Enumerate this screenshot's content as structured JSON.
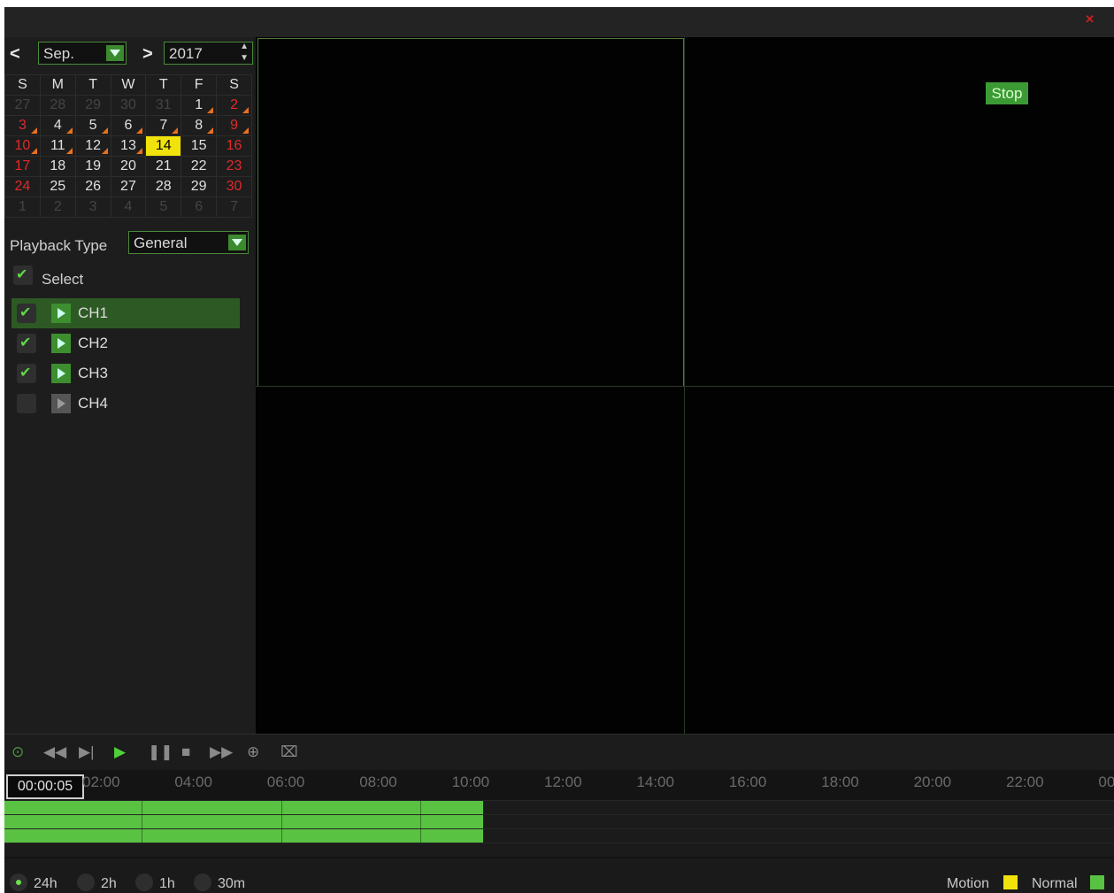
{
  "calendar": {
    "month": "Sep.",
    "year": "2017",
    "weekdays": [
      "S",
      "M",
      "T",
      "W",
      "T",
      "F",
      "S"
    ],
    "weeks": [
      [
        "27",
        "28",
        "29",
        "30",
        "31",
        "1",
        "2"
      ],
      [
        "3",
        "4",
        "5",
        "6",
        "7",
        "8",
        "9"
      ],
      [
        "10",
        "11",
        "12",
        "13",
        "14",
        "15",
        "16"
      ],
      [
        "17",
        "18",
        "19",
        "20",
        "21",
        "22",
        "23"
      ],
      [
        "24",
        "25",
        "26",
        "27",
        "28",
        "29",
        "30"
      ],
      [
        "1",
        "2",
        "3",
        "4",
        "5",
        "6",
        "7"
      ]
    ],
    "selected_day": "14"
  },
  "playback_type": {
    "label": "Playback Type",
    "value": "General"
  },
  "select_all": {
    "label": "Select",
    "checked": true
  },
  "channels": [
    {
      "label": "CH1",
      "checked": true,
      "active": true
    },
    {
      "label": "CH2",
      "checked": true,
      "active": false
    },
    {
      "label": "CH3",
      "checked": true,
      "active": false
    },
    {
      "label": "CH4",
      "checked": false,
      "active": false
    }
  ],
  "video": {
    "stop_label": "Stop"
  },
  "controls": [
    "snapshot-icon",
    "rewind-icon",
    "step-forward-icon",
    "play-icon",
    "pause-icon",
    "stop-icon",
    "fast-forward-icon",
    "zoom-icon",
    "cut-icon"
  ],
  "timeline": {
    "current_time": "00:00:05",
    "ticks": [
      "02:00",
      "04:00",
      "06:00",
      "08:00",
      "10:00",
      "12:00",
      "14:00",
      "16:00",
      "18:00",
      "20:00",
      "22:00",
      "00"
    ],
    "recorded_until": "10:10"
  },
  "zoom_options": [
    {
      "label": "24h",
      "selected": true
    },
    {
      "label": "2h",
      "selected": false
    },
    {
      "label": "1h",
      "selected": false
    },
    {
      "label": "30m",
      "selected": false
    }
  ],
  "legend": {
    "motion_label": "Motion",
    "motion_color": "#f0e20a",
    "normal_label": "Normal",
    "normal_color": "#5ac243"
  }
}
